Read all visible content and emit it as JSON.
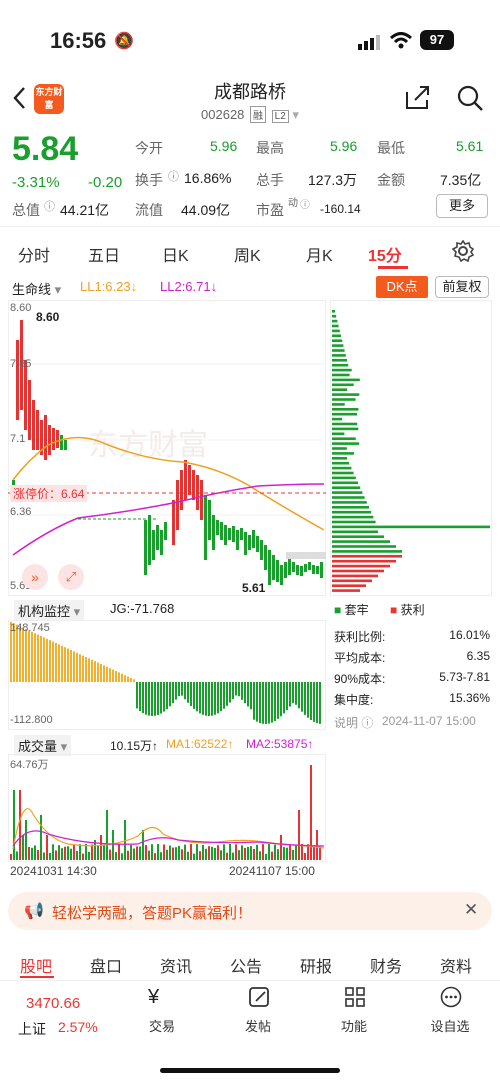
{
  "status": {
    "time": "16:56",
    "battery": "97"
  },
  "header": {
    "logo_text": "东方财富",
    "title": "成都路桥",
    "code": "002628",
    "tags": [
      "融",
      "L2"
    ]
  },
  "quote": {
    "price": "5.84",
    "change_pct": "-3.31%",
    "change": "-0.20",
    "fields": [
      {
        "label": "今开",
        "value": "5.96"
      },
      {
        "label": "最高",
        "value": "5.96"
      },
      {
        "label": "最低",
        "value": "5.61"
      },
      {
        "label": "换手",
        "value": "16.86%"
      },
      {
        "label": "总手",
        "value": "127.3万"
      },
      {
        "label": "金额",
        "value": "7.35亿"
      },
      {
        "label": "总值",
        "value": "44.21亿"
      },
      {
        "label": "流值",
        "value": "44.09亿"
      },
      {
        "label": "市盈",
        "value": "-160.14"
      }
    ],
    "superscript": "动",
    "more": "更多"
  },
  "period_tabs": [
    "分时",
    "五日",
    "日K",
    "周K",
    "月K",
    "15分"
  ],
  "indicator": {
    "name": "生命线",
    "ll1": "LL1:6.23↓",
    "ll2": "LL2:6.71↓",
    "dk_button": "DK点",
    "fq_button": "前复权"
  },
  "chart_labels": {
    "high": "8.60",
    "high_mark": "8.60",
    "y2": "7.85",
    "y3": "7.1",
    "y4": "6.36",
    "low": "5.61",
    "low_mark": "5.61",
    "limit_label": "涨停价：",
    "limit_value": "6.64",
    "watermark": "东方财富"
  },
  "chip": {
    "legend_trapped": "套牢",
    "legend_profit": "获利",
    "rows": [
      {
        "label": "获利比例:",
        "value": "16.01%"
      },
      {
        "label": "平均成本:",
        "value": "6.35"
      },
      {
        "label": "90%成本:",
        "value": "5.73-7.81"
      },
      {
        "label": "集中度:",
        "value": "15.36%"
      }
    ],
    "note_label": "说明",
    "date": "2024-11-07 15:00"
  },
  "jg": {
    "name": "机构监控",
    "value": "JG:-71.768",
    "top": "148.745",
    "bottom": "-112.800"
  },
  "volume": {
    "name": "成交量",
    "vol": "10.15万↑",
    "ma1": "MA1:62522↑",
    "ma2": "MA2:53875↑",
    "top": "64.76万",
    "start": "20241031 14:30",
    "end": "20241107 15:00"
  },
  "promo": {
    "text": "轻松学两融，答题PK赢福利！"
  },
  "bottom_tabs": [
    "股吧",
    "盘口",
    "资讯",
    "公告",
    "研报",
    "财务",
    "资料"
  ],
  "bottom_nav": {
    "index_value": "3470.66",
    "index_name": "上证",
    "index_pct": "2.57%",
    "items": [
      "交易",
      "发帖",
      "功能",
      "设自选"
    ]
  },
  "colors": {
    "up": "#e33333",
    "down": "#1a9e2d",
    "accent": "#f25a1e"
  }
}
